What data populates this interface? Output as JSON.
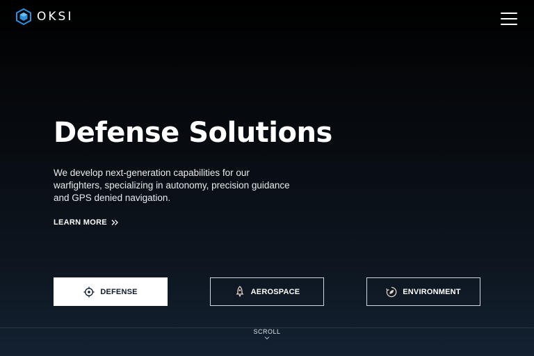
{
  "header": {
    "logo_text": "OKSI",
    "logo_icon": "hexagon-cube-icon",
    "menu_icon": "hamburger-menu-icon"
  },
  "hero": {
    "title": "Defense Solutions",
    "description": "We develop next-generation capabilities for our warfighters, specializing in autonomy, precision guidance and GPS denied navigation.",
    "learn_more_label": "LEARN MORE"
  },
  "categories": [
    {
      "label": "DEFENSE",
      "icon": "crosshair-icon",
      "active": true
    },
    {
      "label": "AEROSPACE",
      "icon": "rocket-icon",
      "active": false
    },
    {
      "label": "ENVIRONMENT",
      "icon": "leaf-cycle-icon",
      "active": false
    }
  ],
  "scroll": {
    "label": "SCROLL",
    "icon": "chevron-down-icon"
  },
  "colors": {
    "background_top": "#000000",
    "background_bottom": "#132131",
    "logo_blue": "#2f8fd8",
    "active_button_bg": "#ffffff",
    "active_button_text": "#0f1b2d",
    "button_border": "#cfd6de"
  }
}
